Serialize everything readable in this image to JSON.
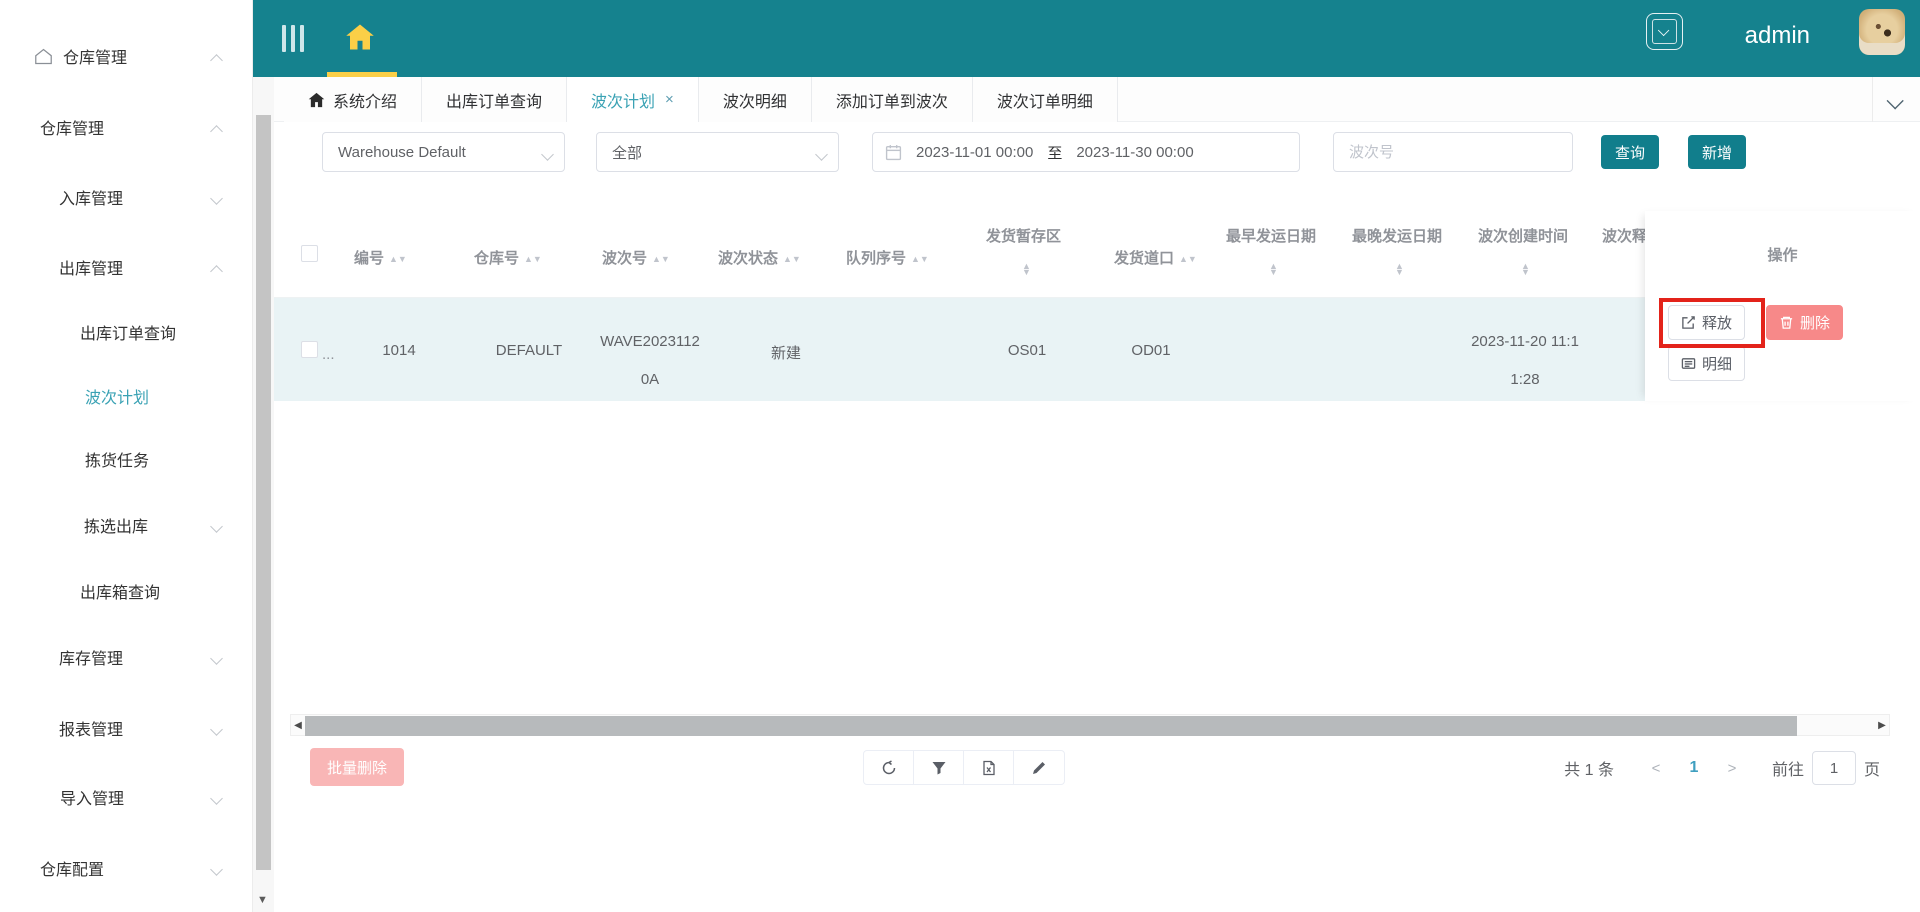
{
  "colors": {
    "teal_header": "#15828e",
    "accent_yellow": "#fbcf47",
    "active_teal": "#3aa2b4",
    "button_teal": "#117e8c",
    "danger": "#f78989",
    "row_bg": "#e9f3f5",
    "annotation_red": "#e3231a"
  },
  "topbar": {
    "admin_label": "admin"
  },
  "sidebar": {
    "items": [
      {
        "label": "仓库管理",
        "level": 1,
        "caret": "up",
        "icon": "home-outline"
      },
      {
        "label": "仓库管理",
        "level": 2,
        "caret": "up"
      },
      {
        "label": "入库管理",
        "level": 3,
        "caret": "down"
      },
      {
        "label": "出库管理",
        "level": 3,
        "caret": "up"
      },
      {
        "label": "出库订单查询",
        "level": 4
      },
      {
        "label": "波次计划",
        "level": 4,
        "active": true
      },
      {
        "label": "拣货任务",
        "level": 4
      },
      {
        "label": "拣选出库",
        "level": 4,
        "caret": "down"
      },
      {
        "label": "出库箱查询",
        "level": 4
      },
      {
        "label": "库存管理",
        "level": 3,
        "caret": "down"
      },
      {
        "label": "报表管理",
        "level": 3,
        "caret": "down"
      },
      {
        "label": "导入管理",
        "level": 3,
        "caret": "down"
      },
      {
        "label": "仓库配置",
        "level": 2,
        "caret": "down"
      }
    ]
  },
  "tabs": [
    {
      "label": "系统介绍",
      "icon": "home"
    },
    {
      "label": "出库订单查询"
    },
    {
      "label": "波次计划",
      "active": true,
      "close": "×"
    },
    {
      "label": "波次明细"
    },
    {
      "label": "添加订单到波次"
    },
    {
      "label": "波次订单明细"
    }
  ],
  "filters": {
    "warehouse_value": "Warehouse Default",
    "status_value": "全部",
    "date_from": "2023-11-01 00:00",
    "date_separator": "至",
    "date_to": "2023-11-30 00:00",
    "wave_no_placeholder": "波次号",
    "query_button": "查询",
    "add_button": "新增"
  },
  "table": {
    "columns": [
      "编号",
      "仓库号",
      "波次号",
      "波次状态",
      "队列序号",
      "发货暂存区",
      "发货道口",
      "最早发运日期",
      "最晚发运日期",
      "波次创建时间",
      "波次释",
      "操作"
    ],
    "row": {
      "ellipsis": "...",
      "id": "1014",
      "warehouse": "DEFAULT",
      "wave_no": "WAVE20231120A",
      "status": "新建",
      "queue_seq": "",
      "staging_area": "OS01",
      "dock": "OD01",
      "earliest_ship_date": "",
      "latest_ship_date": "",
      "created_at": "2023-11-20 11:11:28",
      "actions": {
        "release": "释放",
        "delete": "删除",
        "detail": "明细"
      }
    }
  },
  "footer": {
    "batch_delete": "批量删除",
    "total": "共 1 条",
    "prev": "<",
    "page": "1",
    "next": ">",
    "goto_label": "前往",
    "goto_value": "1",
    "page_suffix": "页"
  }
}
